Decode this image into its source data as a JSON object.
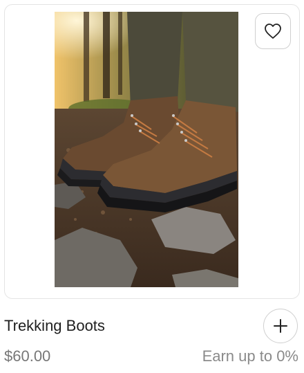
{
  "product": {
    "image_alt": "hiking boots on a forest trail",
    "title": "Trekking Boots",
    "price": "$60.00",
    "earn_text": "Earn up to 0%"
  },
  "icons": {
    "favorite": "heart-icon",
    "add": "plus-icon"
  },
  "colors": {
    "text_primary": "#1f1f1f",
    "text_secondary": "#777777",
    "border": "#e4e4e4"
  }
}
